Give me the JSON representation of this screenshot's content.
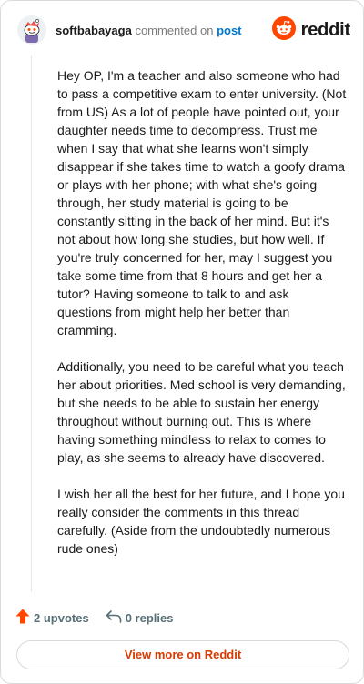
{
  "header": {
    "username": "softbabayaga",
    "action_text": "commented on",
    "post_link": "post",
    "brand": "reddit"
  },
  "comment": {
    "paragraphs": [
      "Hey OP, I'm a teacher and also someone who had to pass a competitive exam to enter university. (Not from US) As a lot of people have pointed out, your daughter needs time to decompress. Trust me when I say that what she learns won't simply disappear if she takes time to watch a goofy drama or plays with her phone; with what she's going through, her study material is going to be constantly sitting in the back of her mind. But it's not about how long she studies, but how well. If you're truly concerned for her, may I suggest you take some time from that 8 hours and get her a tutor? Having someone to talk to and ask questions from might help her better than cramming.",
      "Additionally, you need to be careful what you teach her about priorities. Med school is very demanding, but she needs to be able to sustain her energy throughout without burning out. This is where having something mindless to relax to comes to play, as she seems to already have discovered.",
      "I wish her all the best for her future, and I hope you really consider the comments in this thread carefully. (Aside from the undoubtedly numerous rude ones)"
    ]
  },
  "actions": {
    "upvotes": "2 upvotes",
    "replies": "0 replies"
  },
  "footer": {
    "view_more": "View more on Reddit"
  },
  "colors": {
    "upvote": "#ff4500",
    "link": "#0079d3",
    "view_more": "#d93a00",
    "brand": "#ff4500"
  },
  "icons": {
    "avatar": "snoo-avatar-icon",
    "brand": "reddit-logo-icon",
    "upvote": "upvote-arrow-icon",
    "reply": "reply-arrow-icon"
  }
}
